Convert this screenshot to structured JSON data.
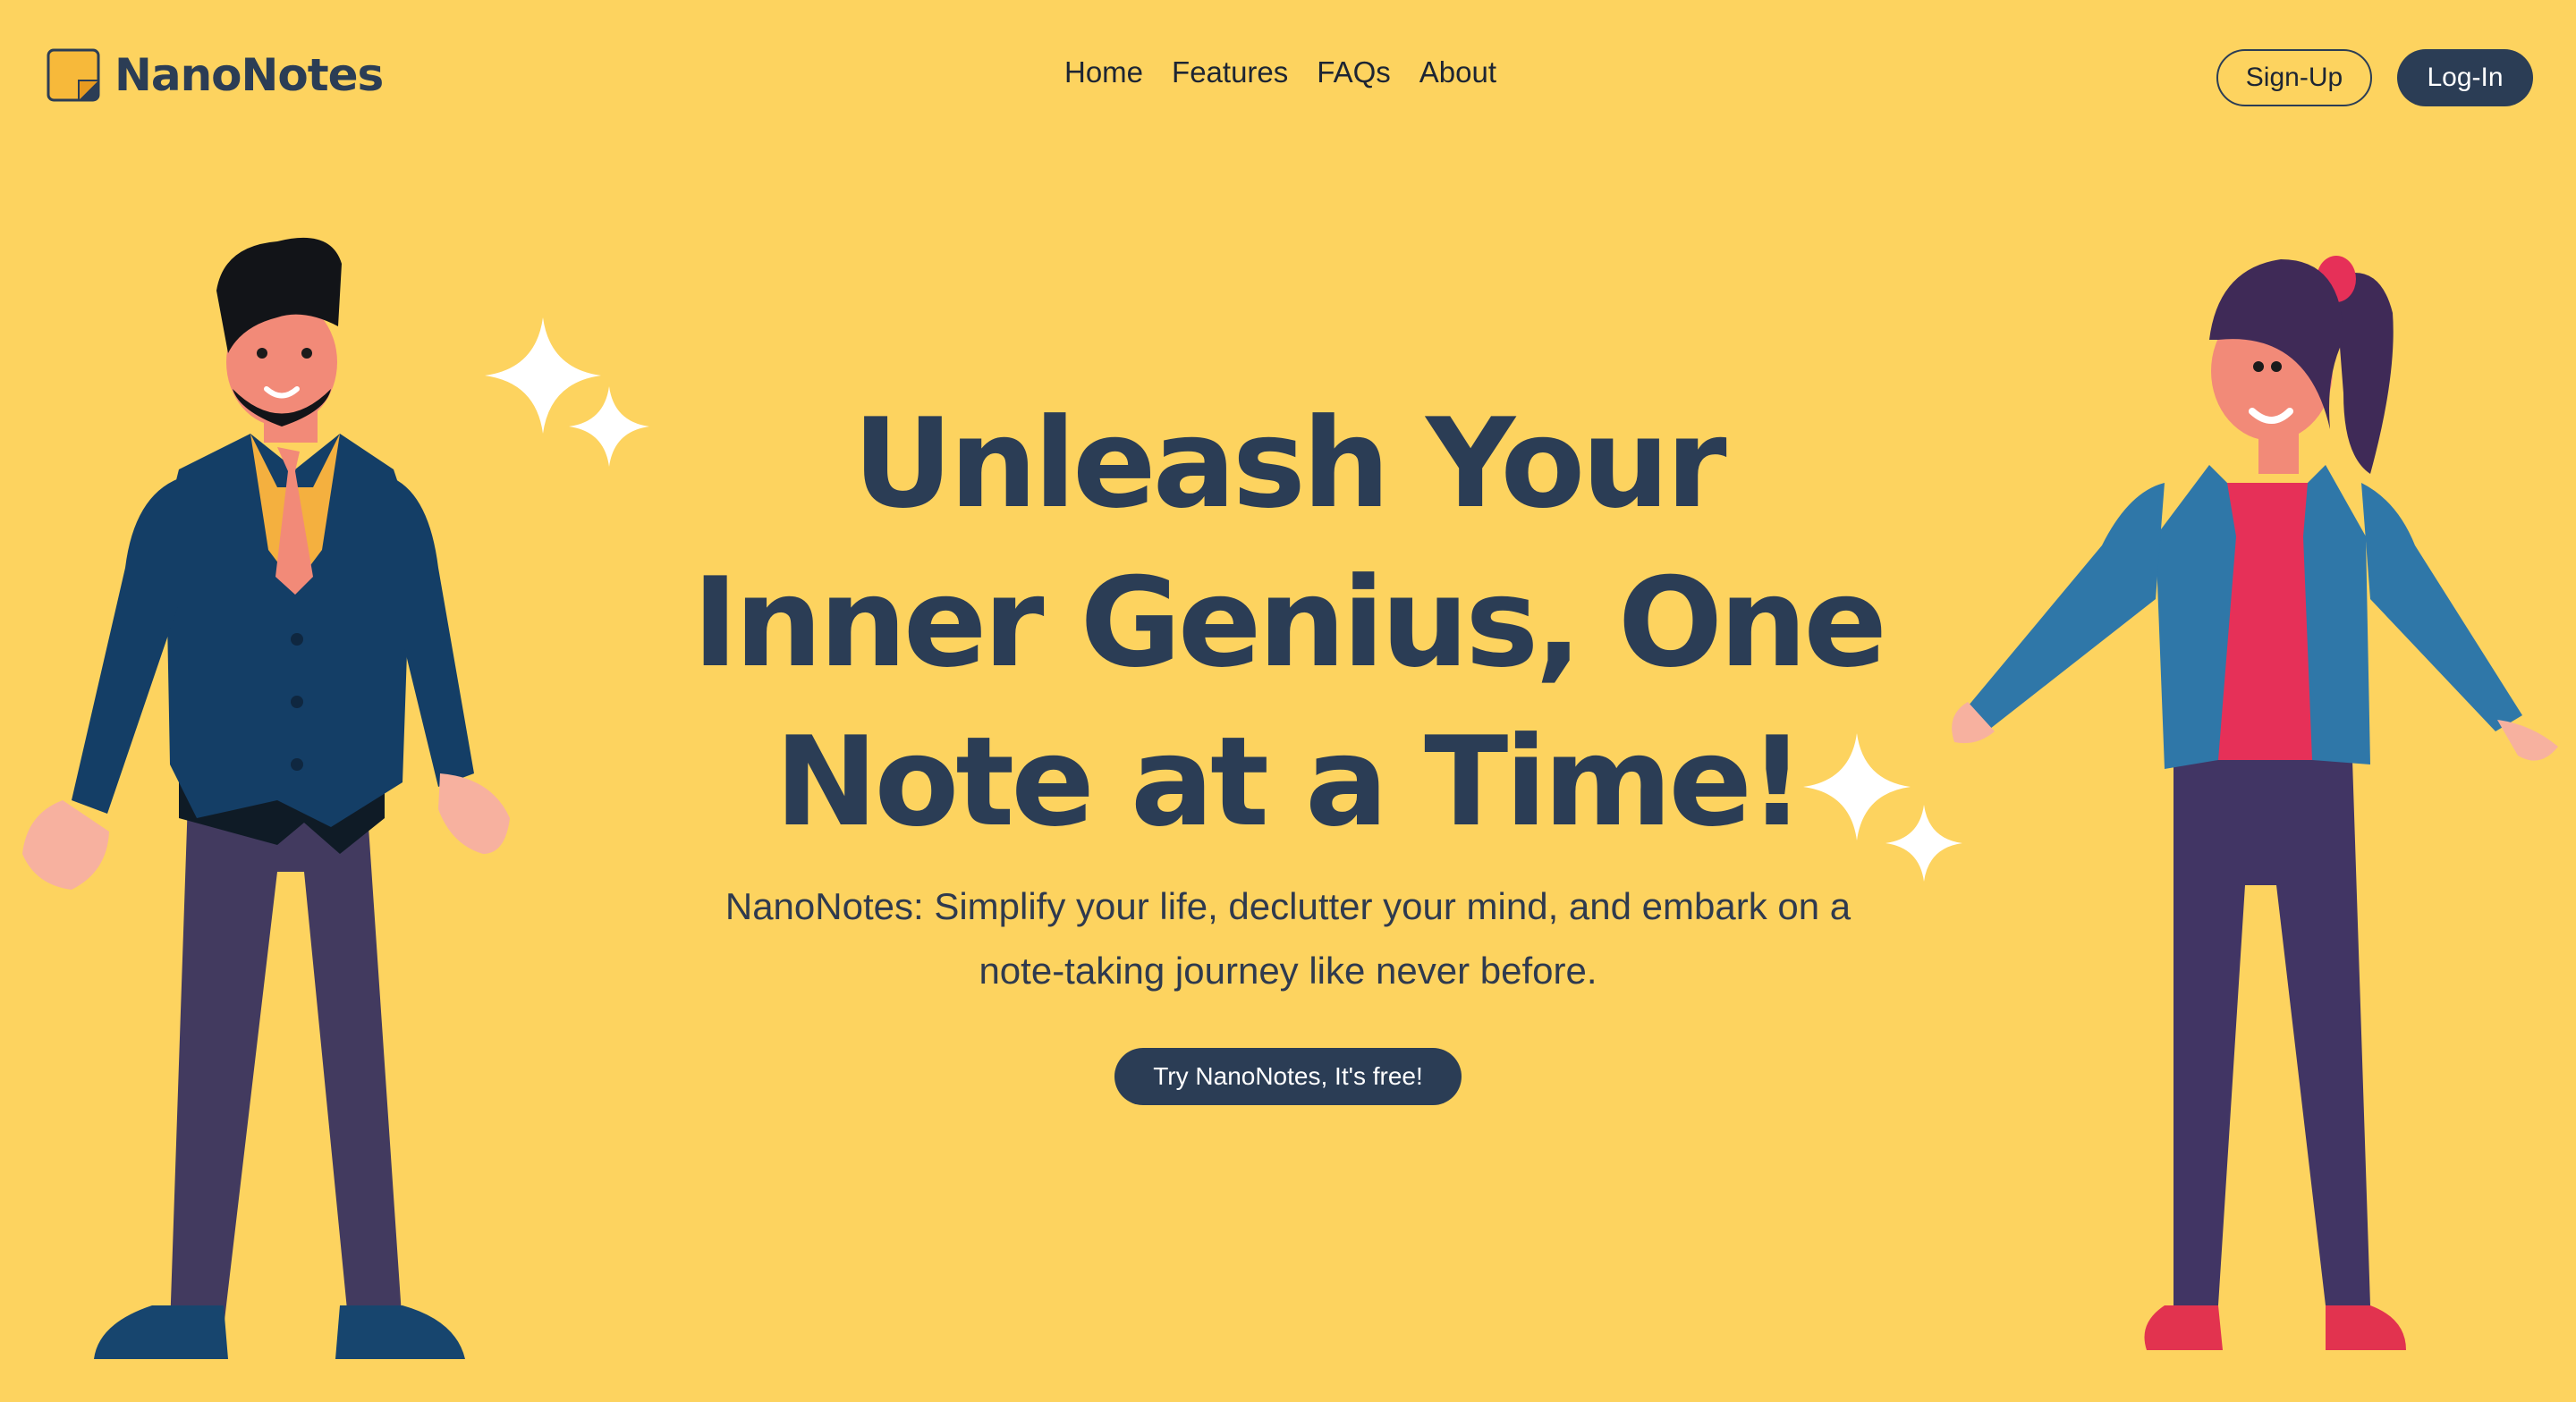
{
  "brand": {
    "name": "NanoNotes",
    "icon": "sticky-note-icon"
  },
  "nav": {
    "items": [
      {
        "label": "Home"
      },
      {
        "label": "Features"
      },
      {
        "label": "FAQs"
      },
      {
        "label": "About"
      }
    ]
  },
  "auth": {
    "signup_label": "Sign-Up",
    "login_label": "Log-In"
  },
  "hero": {
    "title_lines": [
      "Unleash Your",
      "Inner Genius, One",
      "Note at a Time!"
    ],
    "subtitle_lines": [
      "NanoNotes: Simplify your life, declutter your mind, and embark on a",
      "note-taking journey like never before."
    ],
    "cta_label": "Try NanoNotes, It's free!"
  },
  "illustrations": {
    "left": "man-in-suit-illustration",
    "right": "woman-in-jacket-illustration",
    "decor": "sparkle-icon"
  },
  "colors": {
    "background": "#fdd35f",
    "primary": "#2b3d55",
    "text": "#1d2533",
    "white": "#ffffff"
  }
}
